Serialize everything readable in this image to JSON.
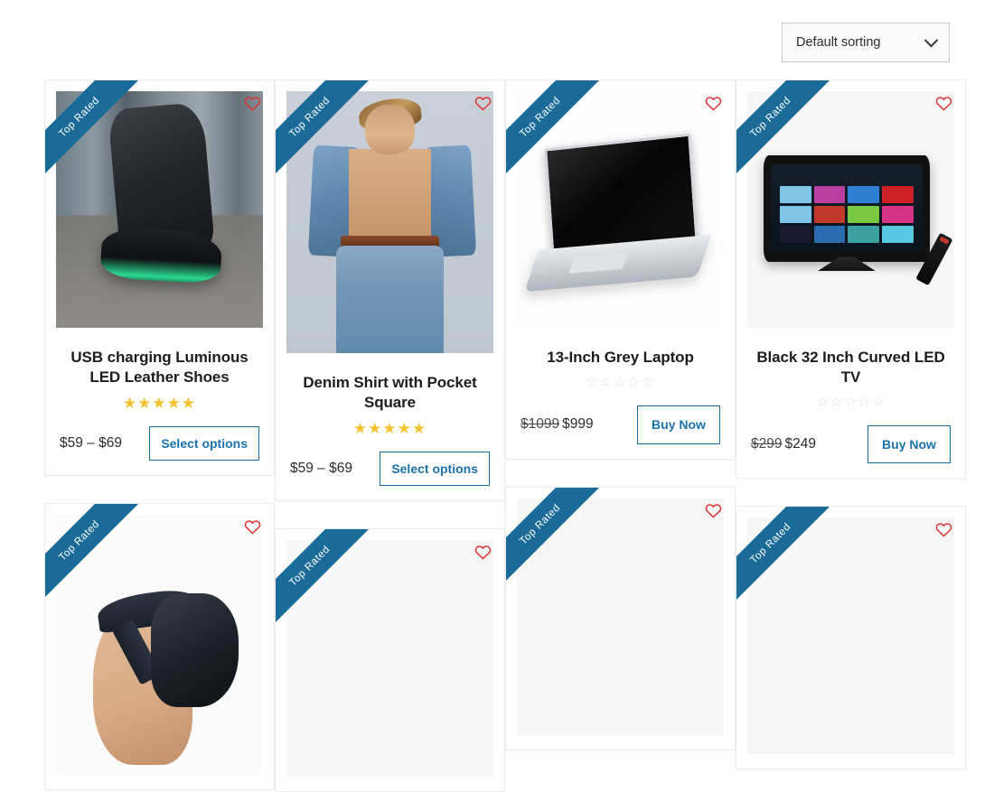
{
  "toolbar": {
    "sort_value": "Default sorting",
    "sort_options": [
      "Default sorting"
    ],
    "chevron_icon": "chevron-down-icon"
  },
  "labels": {
    "ribbon": "Top Rated",
    "wishlist_icon": "heart-icon",
    "star_filled": "★",
    "star_empty": "☆"
  },
  "colors": {
    "ribbon_blue": "#1b6b98",
    "button_border": "#1b6b98",
    "button_text": "#1b72aa",
    "star_filled": "#f2c230",
    "star_empty": "#e2e2e2",
    "wishlist_red": "#e03131"
  },
  "products": [
    {
      "title": "USB charging Luminous LED Leather Shoes",
      "rating": 5,
      "rating_empty": false,
      "price": "$59 – $69",
      "price_old": "",
      "button": "Select options",
      "badge": "Top Rated",
      "image": "running-shoes-photo"
    },
    {
      "title": "Denim Shirt with Pocket Square",
      "rating": 5,
      "rating_empty": false,
      "price": "$59 – $69",
      "price_old": "",
      "button": "Select options",
      "badge": "Top Rated",
      "image": "denim-shirt-model-photo"
    },
    {
      "title": "13-Inch Grey Laptop",
      "rating": 0,
      "rating_empty": true,
      "price": "$999",
      "price_old": "$1099",
      "button": "Buy Now",
      "badge": "Top Rated",
      "image": "grey-laptop-photo"
    },
    {
      "title": "Black 32 Inch Curved LED TV",
      "rating": 0,
      "rating_empty": true,
      "price": "$249",
      "price_old": "$299",
      "button": "Buy Now",
      "badge": "Top Rated",
      "image": "curved-led-tv-photo"
    },
    {
      "title": "",
      "rating": 0,
      "rating_empty": true,
      "price": "",
      "price_old": "",
      "button": "",
      "badge": "Top Rated",
      "image": "vr-headset-photo"
    },
    {
      "title": "",
      "rating": 0,
      "rating_empty": true,
      "price": "",
      "price_old": "",
      "button": "",
      "badge": "Top Rated",
      "image": "placeholder-photo"
    },
    {
      "title": "",
      "rating": 0,
      "rating_empty": true,
      "price": "",
      "price_old": "",
      "button": "",
      "badge": "Top Rated",
      "image": "placeholder-photo"
    },
    {
      "title": "",
      "rating": 0,
      "rating_empty": true,
      "price": "",
      "price_old": "",
      "button": "",
      "badge": "Top Rated",
      "image": "placeholder-photo"
    }
  ]
}
